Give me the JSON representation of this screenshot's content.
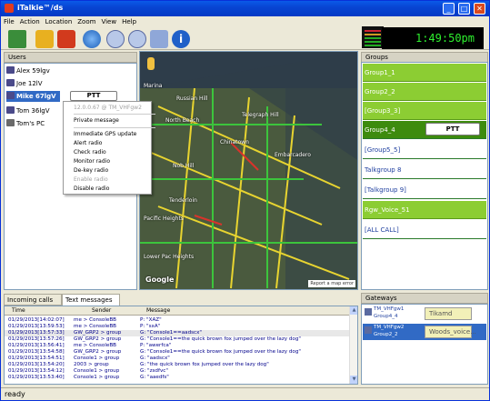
{
  "window": {
    "title": "iTalkie™/ds"
  },
  "menu": [
    "File",
    "Action",
    "Location",
    "Zoom",
    "View",
    "Help"
  ],
  "toolbar": {
    "icons": [
      "logout-icon",
      "undo-icon",
      "emergency-icon",
      "globe-icon",
      "zoom-in-icon",
      "zoom-out-icon",
      "settings-icon",
      "info-icon"
    ]
  },
  "clock": "1:49:50pm",
  "users": {
    "header": "Users",
    "items": [
      "Alex 59lgv",
      "Joe 12lV",
      "Mike 67lgV",
      "Tom 36lgV",
      "Tom's PC"
    ],
    "ptt_label": "PTT"
  },
  "context_menu": {
    "ip": "12.0.0.67 @ TM_VHFgw2",
    "items": [
      "Private message",
      "Immediate GPS update",
      "Alert radio",
      "Check radio",
      "Monitor radio",
      "De-key radio",
      "Enable radio",
      "Disable radio"
    ]
  },
  "map": {
    "labels": [
      "Russian Hill",
      "North Beach",
      "Chinatown",
      "Telegraph Hill",
      "Nob Hill",
      "Tenderloin",
      "Embarcadero",
      "Marina",
      "Pacific Heights",
      "Lower Pac Heights"
    ],
    "google": "Google",
    "report": "Report a map error"
  },
  "groups": {
    "header": "Groups",
    "items": [
      "Group1_1",
      "Group2_2",
      "[Group3_3]",
      "Group4_4",
      "[Group5_5]",
      "Talkgroup 8",
      "[Talkgroup 9]",
      "Rgw_Voice_51",
      "[ALL CALL]"
    ],
    "ptt_label": "PTT"
  },
  "tabs": [
    "Incoming calls",
    "Text messages"
  ],
  "log": {
    "headers": [
      "Time",
      "Sender",
      "Message"
    ],
    "rows": [
      [
        "01/29/2013[14:02:07]",
        "me > ConsoleBB",
        "P: \"XAZ\""
      ],
      [
        "01/29/2013[13:59:53]",
        "me > ConsoleBB",
        "P: \"sxA\""
      ],
      [
        "01/29/2013[13:57:33]",
        "GW_GRP2 > group",
        "G: \"Console1==aadscx\""
      ],
      [
        "01/29/2013[13:57:26]",
        "GW_GRP2 > group",
        "G: \"Console1==the quick brown fox jumped over the lazy dog\""
      ],
      [
        "01/29/2013[13:56:41]",
        "me > ConsoleBB",
        "P: \"awerfca\""
      ],
      [
        "01/29/2013[13:54:58]",
        "GW_GRP2 > group",
        "G: \"Console1==the quick brown fox jumped over the lazy dog\""
      ],
      [
        "01/29/2013[13:54:51]",
        "Console1 > group",
        "G: \"aadscx\""
      ],
      [
        "01/29/2013[13:54:20]",
        "2003 > group",
        "G: \"the quick brown fox jumped over the lazy dog\""
      ],
      [
        "01/29/2013[13:54:12]",
        "Console1 > group",
        "G: \"zsdfvc\""
      ],
      [
        "01/29/2013[13:53:40]",
        "Console1 > group",
        "G: \"aaedfs\""
      ]
    ]
  },
  "gateways": {
    "header": "Gateways",
    "items": [
      {
        "name": "TM_VHFgw1",
        "group": "Group4_4",
        "box": "Tikamd"
      },
      {
        "name": "TM_VHFgw2",
        "group": "Group2_2",
        "box": "Woods_voice..."
      }
    ]
  },
  "status": "ready"
}
